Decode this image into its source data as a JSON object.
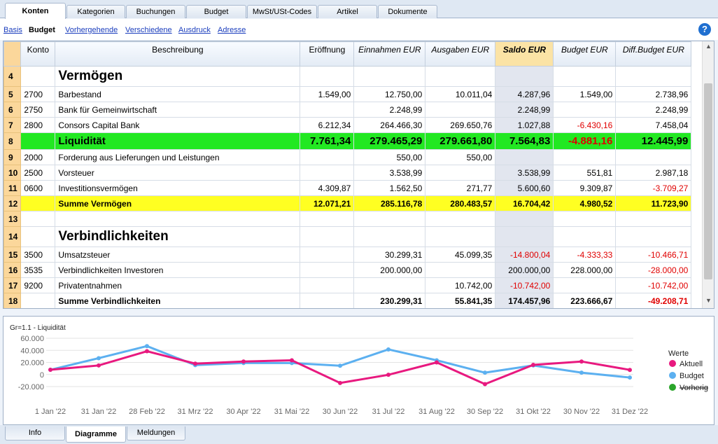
{
  "tabs": [
    "Konten",
    "Kategorien",
    "Buchungen",
    "Budget",
    "MwSt/USt-Codes",
    "Artikel",
    "Dokumente"
  ],
  "subnav": {
    "links": [
      "Basis",
      "Vorhergehende",
      "Verschiedene",
      "Ausdruck",
      "Adresse"
    ],
    "current": "Budget"
  },
  "columns": {
    "konto": "Konto",
    "beschreibung": "Beschreibung",
    "eroeffnung": "Eröffnung",
    "einnahmen": "Einnahmen EUR",
    "ausgaben": "Ausgaben EUR",
    "saldo": "Saldo EUR",
    "budget": "Budget EUR",
    "diff": "Diff.Budget EUR"
  },
  "rows": [
    {
      "n": "4",
      "konto": "",
      "desc": "Vermögen",
      "e": "",
      "ein": "",
      "aus": "",
      "sal": "",
      "bud": "",
      "diff": "",
      "type": "big"
    },
    {
      "n": "5",
      "konto": "2700",
      "desc": "Barbestand",
      "e": "1.549,00",
      "ein": "12.750,00",
      "aus": "10.011,04",
      "sal": "4.287,96",
      "bud": "1.549,00",
      "diff": "2.738,96"
    },
    {
      "n": "6",
      "konto": "2750",
      "desc": "Bank für Gemeinwirtschaft",
      "e": "",
      "ein": "2.248,99",
      "aus": "",
      "sal": "2.248,99",
      "bud": "",
      "diff": "2.248,99"
    },
    {
      "n": "7",
      "konto": "2800",
      "desc": "Consors Capital Bank",
      "e": "6.212,34",
      "ein": "264.466,30",
      "aus": "269.650,76",
      "sal": "1.027,88",
      "bud": "-6.430,16",
      "diff": "7.458,04"
    },
    {
      "n": "8",
      "konto": "",
      "desc": "Liquidität",
      "e": "7.761,34",
      "ein": "279.465,29",
      "aus": "279.661,80",
      "sal": "7.564,83",
      "bud": "-4.881,16",
      "diff": "12.445,99",
      "type": "liq"
    },
    {
      "n": "9",
      "konto": "2000",
      "desc": "Forderung aus Lieferungen und Leistungen",
      "e": "",
      "ein": "550,00",
      "aus": "550,00",
      "sal": "",
      "bud": "",
      "diff": ""
    },
    {
      "n": "10",
      "konto": "2500",
      "desc": "Vorsteuer",
      "e": "",
      "ein": "3.538,99",
      "aus": "",
      "sal": "3.538,99",
      "bud": "551,81",
      "diff": "2.987,18"
    },
    {
      "n": "11",
      "konto": "0600",
      "desc": "Investitionsvermögen",
      "e": "4.309,87",
      "ein": "1.562,50",
      "aus": "271,77",
      "sal": "5.600,60",
      "bud": "9.309,87",
      "diff": "-3.709,27"
    },
    {
      "n": "12",
      "konto": "",
      "desc": "Summe Vermögen",
      "e": "12.071,21",
      "ein": "285.116,78",
      "aus": "280.483,57",
      "sal": "16.704,42",
      "bud": "4.980,52",
      "diff": "11.723,90",
      "type": "sumv"
    },
    {
      "n": "13",
      "konto": "",
      "desc": "",
      "e": "",
      "ein": "",
      "aus": "",
      "sal": "",
      "bud": "",
      "diff": ""
    },
    {
      "n": "14",
      "konto": "",
      "desc": "Verbindlichkeiten",
      "e": "",
      "ein": "",
      "aus": "",
      "sal": "",
      "bud": "",
      "diff": "",
      "type": "big"
    },
    {
      "n": "15",
      "konto": "3500",
      "desc": "Umsatzsteuer",
      "e": "",
      "ein": "30.299,31",
      "aus": "45.099,35",
      "sal": "-14.800,04",
      "bud": "-4.333,33",
      "diff": "-10.466,71"
    },
    {
      "n": "16",
      "konto": "3535",
      "desc": "Verbindlichkeiten Investoren",
      "e": "",
      "ein": "200.000,00",
      "aus": "",
      "sal": "200.000,00",
      "bud": "228.000,00",
      "diff": "-28.000,00"
    },
    {
      "n": "17",
      "konto": "9200",
      "desc": "Privatentnahmen",
      "e": "",
      "ein": "",
      "aus": "10.742,00",
      "sal": "-10.742,00",
      "bud": "",
      "diff": "-10.742,00"
    },
    {
      "n": "18",
      "konto": "",
      "desc": "Summe Verbindlichkeiten",
      "e": "",
      "ein": "230.299,31",
      "aus": "55.841,35",
      "sal": "174.457,96",
      "bud": "223.666,67",
      "diff": "-49.208,71",
      "type": "sumb"
    }
  ],
  "chart_data": {
    "type": "line",
    "title": "Gr=1.1 - Liquidität",
    "categories": [
      "1 Jan '22",
      "31 Jan '22",
      "28 Feb '22",
      "31 Mrz '22",
      "30 Apr '22",
      "31 Mai '22",
      "30 Jun '22",
      "31 Jul '22",
      "31 Aug '22",
      "30 Sep '22",
      "31 Okt '22",
      "30 Nov '22",
      "31 Dez '22"
    ],
    "yticks": [
      "60.000",
      "40.000",
      "20.000",
      "0",
      "-20.000"
    ],
    "ylim": [
      -20000,
      60000
    ],
    "series": [
      {
        "name": "Aktuell",
        "color": "#e8197f",
        "values": [
          7800,
          15000,
          38500,
          18000,
          21500,
          23500,
          -14000,
          -500,
          20000,
          -16000,
          16000,
          21500,
          7600
        ]
      },
      {
        "name": "Budget",
        "color": "#5cb0f0",
        "values": [
          7800,
          27000,
          47000,
          15500,
          19000,
          19000,
          14500,
          41500,
          23500,
          3000,
          15000,
          3000,
          -5000
        ]
      },
      {
        "name": "Vorherig",
        "color": "#2aa52a",
        "values": []
      }
    ],
    "legend_title": "Werte",
    "legend_position": "right"
  },
  "bottom_tabs": [
    "Info",
    "Diagramme",
    "Meldungen"
  ]
}
